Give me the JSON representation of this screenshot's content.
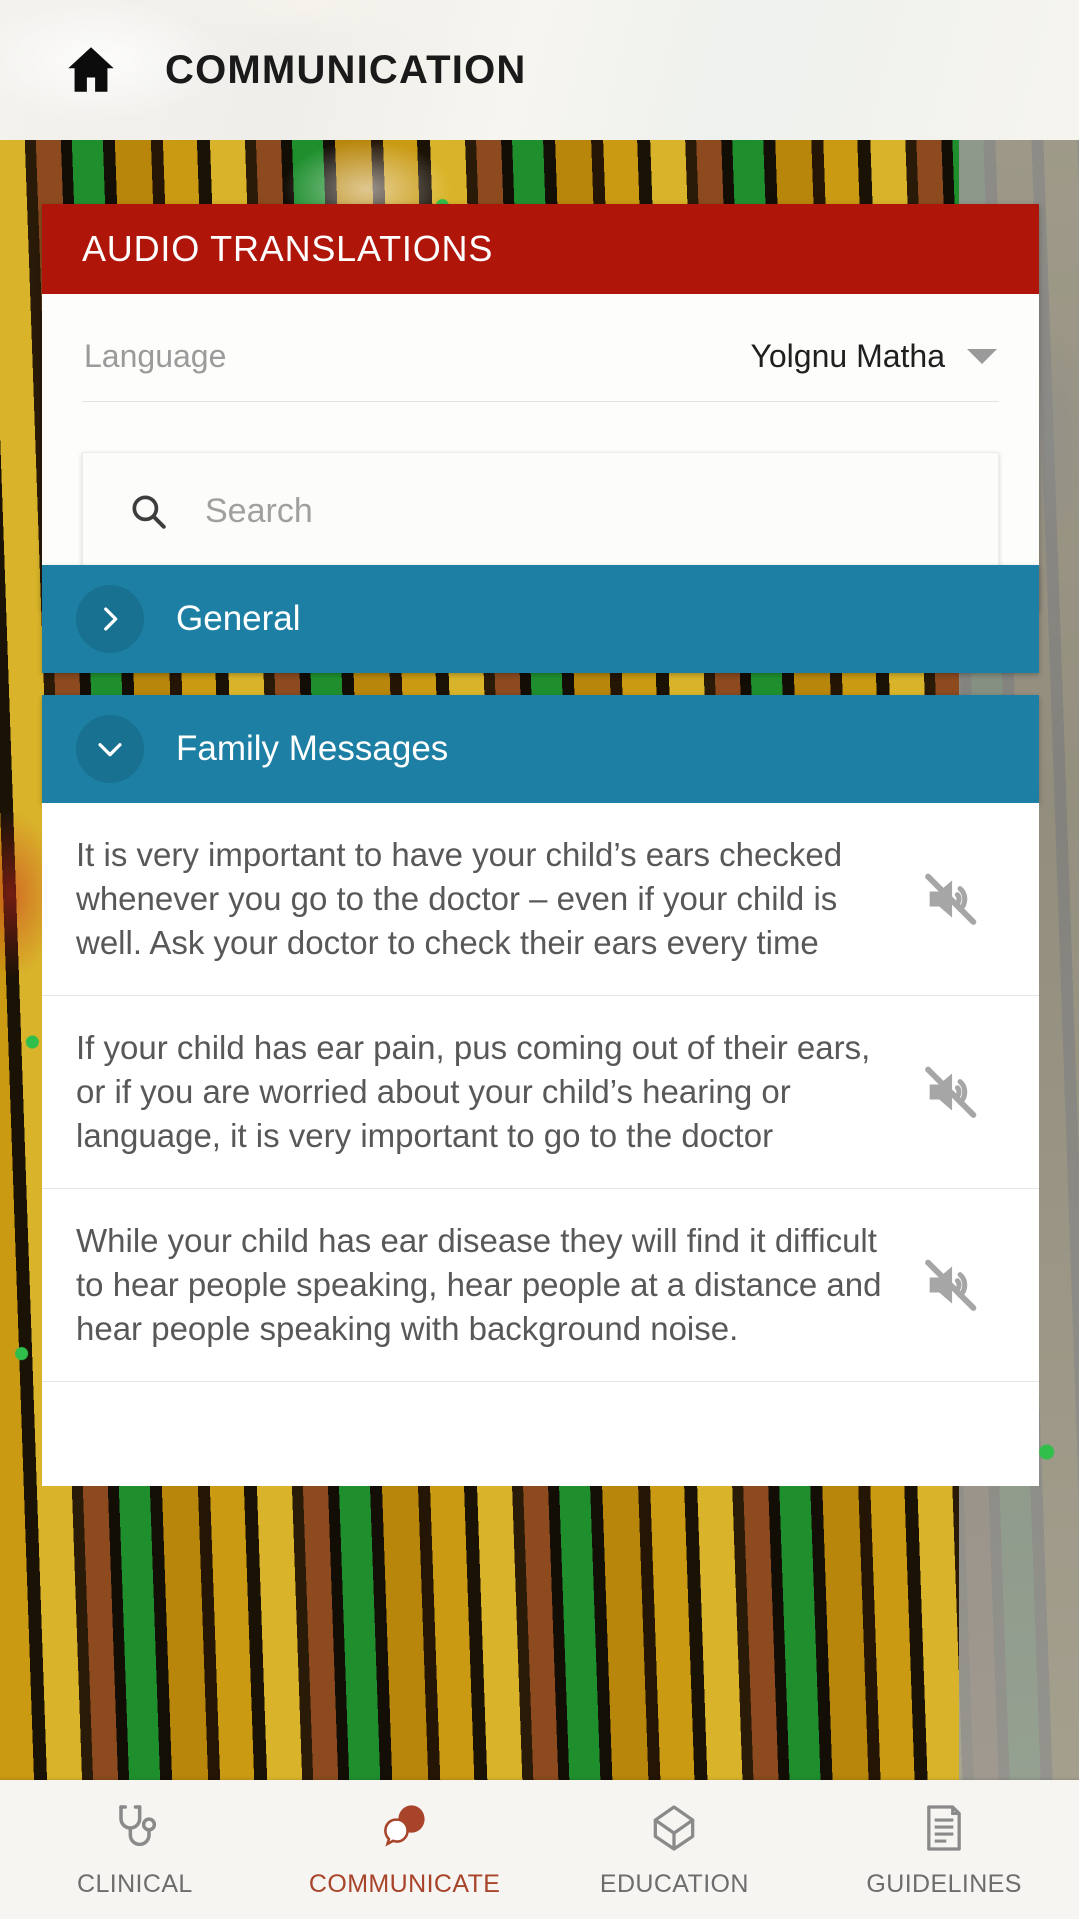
{
  "header": {
    "title": "COMMUNICATION",
    "home_icon": "home-icon"
  },
  "colors": {
    "banner_red": "#b01509",
    "accordion_blue": "#1c7fa3",
    "active_nav": "#a8442a",
    "body_text": "#585858",
    "placeholder": "#a0a09e"
  },
  "card": {
    "banner_title": "AUDIO TRANSLATIONS",
    "language": {
      "label": "Language",
      "value": "Yolgnu Matha",
      "caret_icon": "chevron-down-icon"
    },
    "search": {
      "placeholder": "Search",
      "value": "",
      "icon": "search-icon"
    }
  },
  "accordions": [
    {
      "title": "General",
      "expanded": false,
      "chevron_icon": "chevron-right-icon",
      "messages": []
    },
    {
      "title": "Family Messages",
      "expanded": true,
      "chevron_icon": "chevron-down-icon",
      "messages": [
        {
          "text": "It is very important to have your child’s ears checked whenever you go to the doctor – even if your child is well. Ask your doctor to check their ears every time",
          "audio_icon": "volume-off-icon"
        },
        {
          "text": "If your child has ear pain, pus coming out of their ears, or if you are worried about your child’s hearing or language, it is very important to go to the doctor",
          "audio_icon": "volume-off-icon"
        },
        {
          "text": "While your child has ear disease they will find it difficult to hear people speaking, hear people at a distance and hear people speaking with background noise.",
          "audio_icon": "volume-off-icon"
        }
      ]
    }
  ],
  "bottom_nav": {
    "items": [
      {
        "label": "CLINICAL",
        "icon": "stethoscope-icon",
        "active": false
      },
      {
        "label": "COMMUNICATE",
        "icon": "speech-bubbles-icon",
        "active": true
      },
      {
        "label": "EDUCATION",
        "icon": "graduation-cap-icon",
        "active": false
      },
      {
        "label": "GUIDELINES",
        "icon": "document-lines-icon",
        "active": false
      }
    ]
  }
}
